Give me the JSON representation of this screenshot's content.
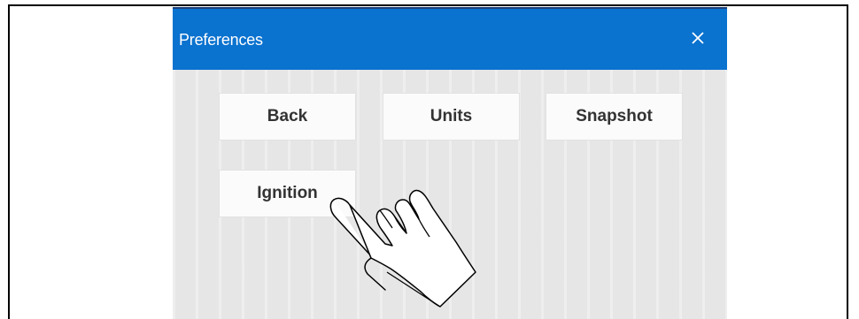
{
  "window": {
    "title": "Preferences",
    "close_icon": "close-icon",
    "titlebar_color": "#0a72cf"
  },
  "buttons": {
    "back": "Back",
    "units": "Units",
    "snapshot": "Snapshot",
    "ignition": "Ignition"
  },
  "pointer": {
    "icon": "hand-pointer-icon",
    "target": "Ignition"
  }
}
